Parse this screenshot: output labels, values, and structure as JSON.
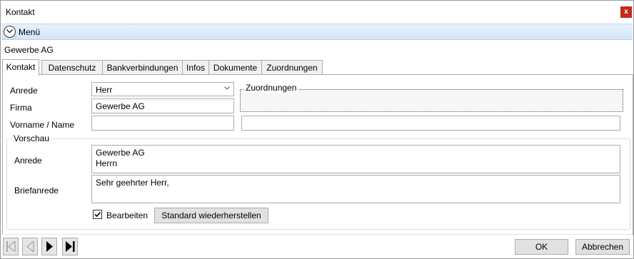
{
  "window": {
    "title": "Kontakt",
    "close_label": "x"
  },
  "menu": {
    "label": "Menü"
  },
  "company": "Gewerbe AG",
  "tabs": [
    {
      "label": "Kontakt",
      "active": true
    },
    {
      "label": "Datenschutz"
    },
    {
      "label": "Bankverbindungen"
    },
    {
      "label": "Infos"
    },
    {
      "label": "Dokumente"
    },
    {
      "label": "Zuordnungen"
    }
  ],
  "form": {
    "anrede_label": "Anrede",
    "anrede_value": "Herr",
    "firma_label": "Firma",
    "firma_value": "Gewerbe AG",
    "name_label": "Vorname / Name",
    "vorname_value": "",
    "name_value": "",
    "zuordnungen_label": "Zuordnungen"
  },
  "preview": {
    "group_label": "Vorschau",
    "anrede_label": "Anrede",
    "anrede_line1": "Gewerbe AG",
    "anrede_line2": "Herrn",
    "briefanrede_label": "Briefanrede",
    "briefanrede_value": "Sehr geehrter Herr,",
    "edit_label": "Bearbeiten",
    "edit_checked": true,
    "reset_button": "Standard wiederherstellen"
  },
  "footer": {
    "ok": "OK",
    "cancel": "Abbrechen"
  },
  "icons": [
    "chevron-down-icon",
    "first-record-icon",
    "previous-record-icon",
    "next-record-icon",
    "last-record-icon",
    "checkmark-icon"
  ],
  "colors": {
    "menubar": "#dbeaf9",
    "close": "#c42b1c"
  }
}
